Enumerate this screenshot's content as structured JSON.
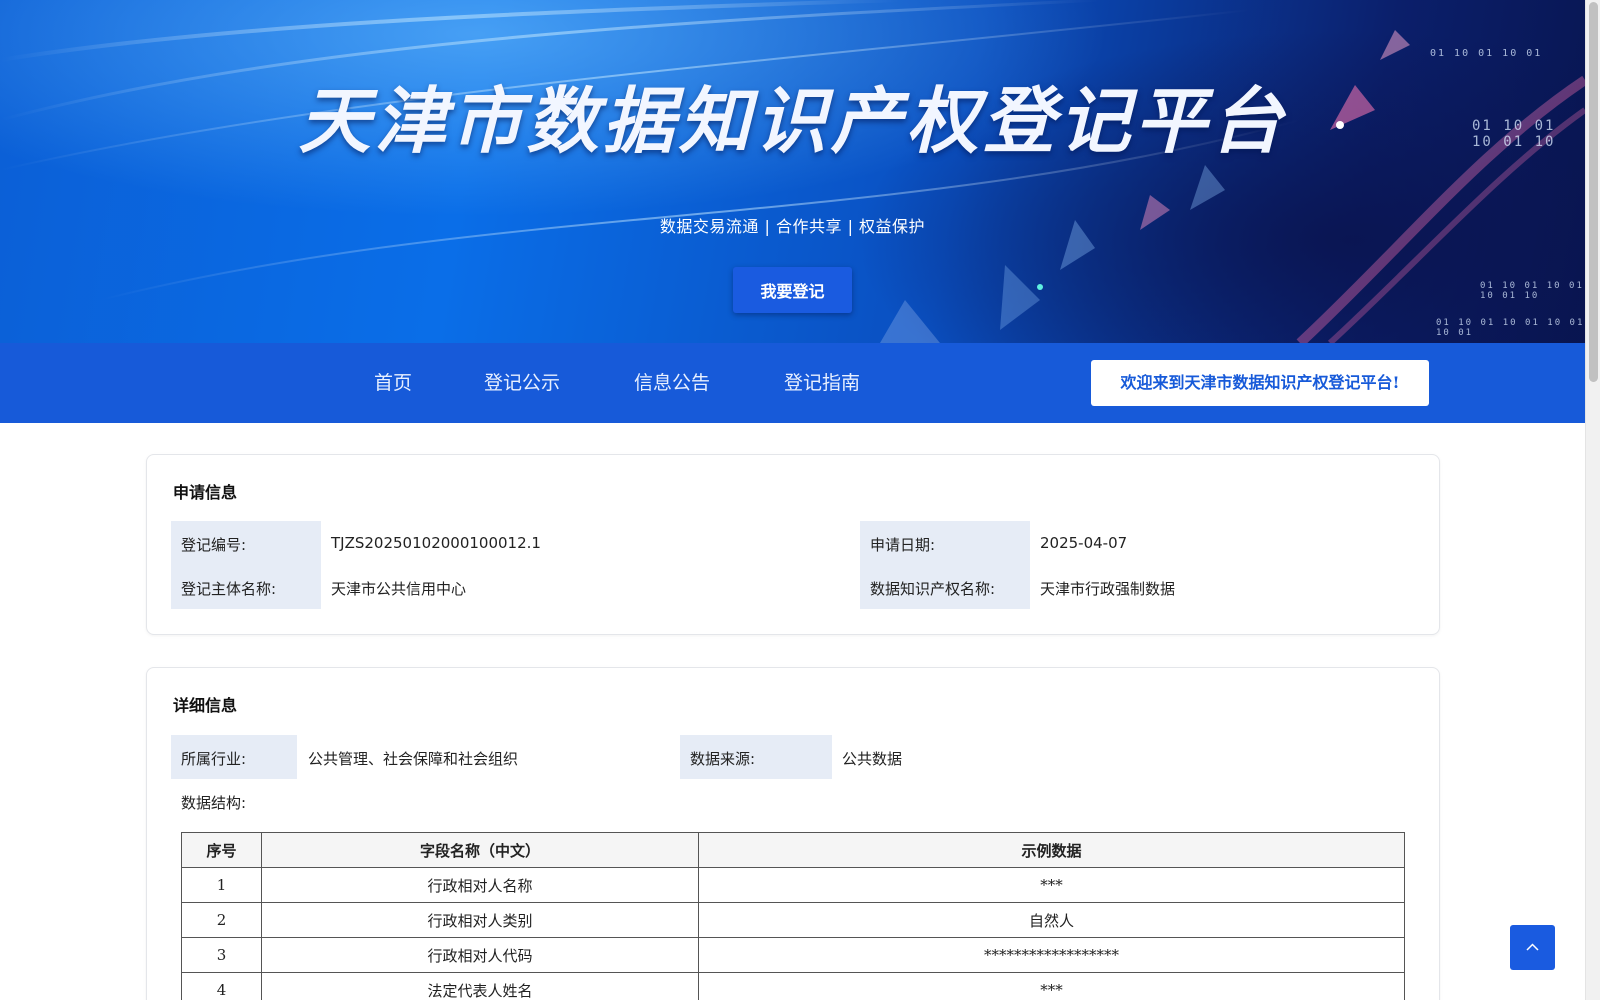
{
  "hero": {
    "title": "天津市数据知识产权登记平台",
    "subtitle": "数据交易流通 | 合作共享 | 权益保护",
    "register_button": "我要登记",
    "binary_lines": [
      "01 10 01 10 01",
      "01 10 01 10 01 10",
      "01 10 01 10 01 10 01 10",
      "01 10 01 10 01 10 01 10 01"
    ]
  },
  "nav": {
    "items": [
      {
        "label": "首页"
      },
      {
        "label": "登记公示"
      },
      {
        "label": "信息公告"
      },
      {
        "label": "登记指南"
      }
    ],
    "welcome": "欢迎来到天津市数据知识产权登记平台!"
  },
  "application_info": {
    "title": "申请信息",
    "reg_no_label": "登记编号:",
    "reg_no_value": "TJZS20250102000100012.1",
    "apply_date_label": "申请日期:",
    "apply_date_value": "2025-04-07",
    "subject_label": "登记主体名称:",
    "subject_value": "天津市公共信用中心",
    "ip_name_label": "数据知识产权名称:",
    "ip_name_value": "天津市行政强制数据"
  },
  "detail_info": {
    "title": "详细信息",
    "industry_label": "所属行业:",
    "industry_value": "公共管理、社会保障和社会组织",
    "source_label": "数据来源:",
    "source_value": "公共数据",
    "structure_label": "数据结构:"
  },
  "table": {
    "headers": [
      "序号",
      "字段名称（中文）",
      "示例数据"
    ],
    "rows": [
      [
        "1",
        "行政相对人名称",
        "***"
      ],
      [
        "2",
        "行政相对人类别",
        "自然人"
      ],
      [
        "3",
        "行政相对人代码",
        "******************"
      ],
      [
        "4",
        "法定代表人姓名",
        "***"
      ]
    ]
  },
  "colors": {
    "brand_blue": "#175ad9",
    "label_bg": "#e6ecf6"
  },
  "icons": {
    "back_to_top": "chevron-up-icon"
  }
}
